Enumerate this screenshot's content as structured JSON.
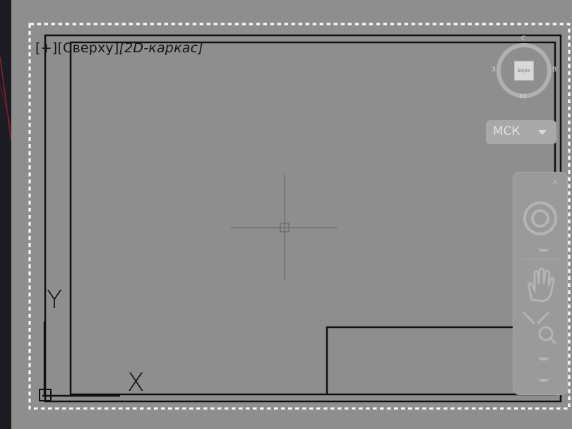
{
  "viewport": {
    "label_plus": "[+]",
    "label_view": "[Сверху]",
    "label_style": "[2D-каркас]"
  },
  "viewcube": {
    "north": "С",
    "south": "Ю",
    "west": "З",
    "east": "В",
    "face": "Верх"
  },
  "wcs": {
    "label": "МСК"
  },
  "ucs": {
    "y_label": "Y",
    "x_label": "X"
  },
  "colors": {
    "background": "#8e8e8e",
    "lines": "#111111",
    "overlay": "#a8a8a8"
  }
}
